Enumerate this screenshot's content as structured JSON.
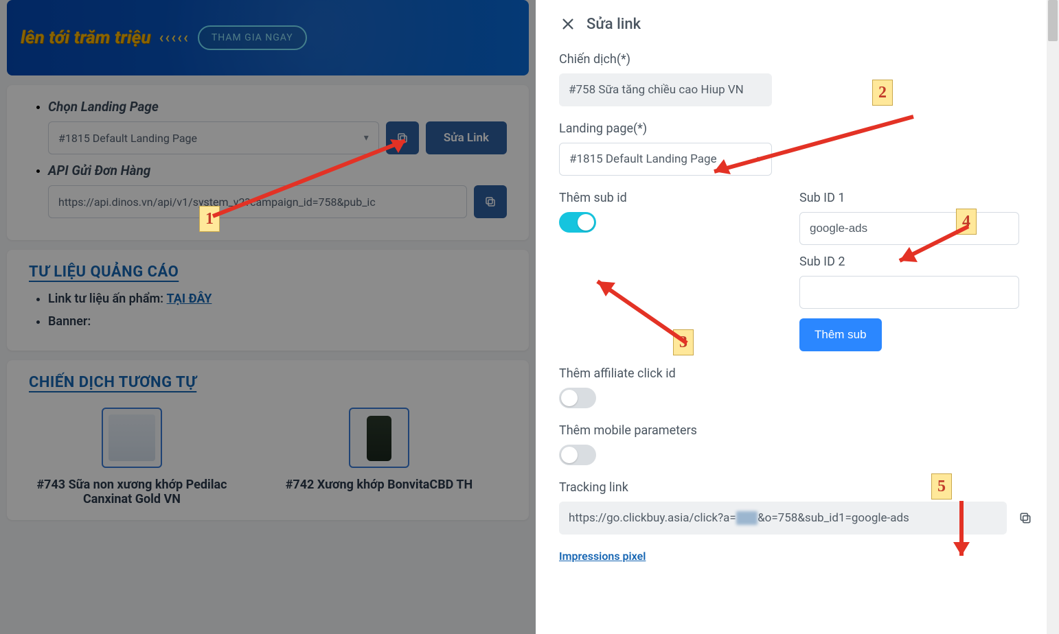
{
  "banner": {
    "text": "lên tới trăm triệu",
    "arrows": "‹‹‹‹‹",
    "cta": "THAM GIA NGAY"
  },
  "main": {
    "landing_label": "Chọn Landing Page",
    "landing_value": "#1815 Default Landing Page",
    "sua_link_btn": "Sửa Link",
    "api_label": "API Gửi Đơn Hàng",
    "api_value": "https://api.dinos.vn/api/v1/system_v2?campaign_id=758&pub_ic",
    "ads_title": "TƯ LIỆU QUẢNG CÁO",
    "ads_item1_pre": "Link tư liệu ấn phẩm: ",
    "ads_item1_link": "TẠI ĐÂY",
    "ads_item2": "Banner:",
    "similar_title": "CHIẾN DỊCH TƯƠNG TỰ",
    "similar": [
      {
        "title": "#743 Sữa non xương khớp Pedilac Canxinat Gold VN"
      },
      {
        "title": "#742 Xương khớp BonvitaCBD TH"
      }
    ]
  },
  "drawer": {
    "title": "Sửa link",
    "campaign_label": "Chiến dịch(*)",
    "campaign_value": "#758 Sữa tăng chiều cao Hiup VN",
    "landing_label": "Landing page(*)",
    "landing_value": "#1815 Default Landing Page",
    "subid_label": "Thêm sub id",
    "sub1_label": "Sub ID 1",
    "sub1_value": "google-ads",
    "sub2_label": "Sub ID 2",
    "sub2_value": "",
    "add_sub_btn": "Thêm sub",
    "clickid_label": "Thêm affiliate click id",
    "mobile_label": "Thêm mobile parameters",
    "tracking_label": "Tracking link",
    "tracking_pre": "https://go.clickbuy.asia/click?a=",
    "tracking_post": "&o=758&sub_id1=google-ads",
    "impressions": "Impressions pixel"
  },
  "annotations": {
    "n1": "1",
    "n2": "2",
    "n3": "3",
    "n4": "4",
    "n5": "5"
  }
}
